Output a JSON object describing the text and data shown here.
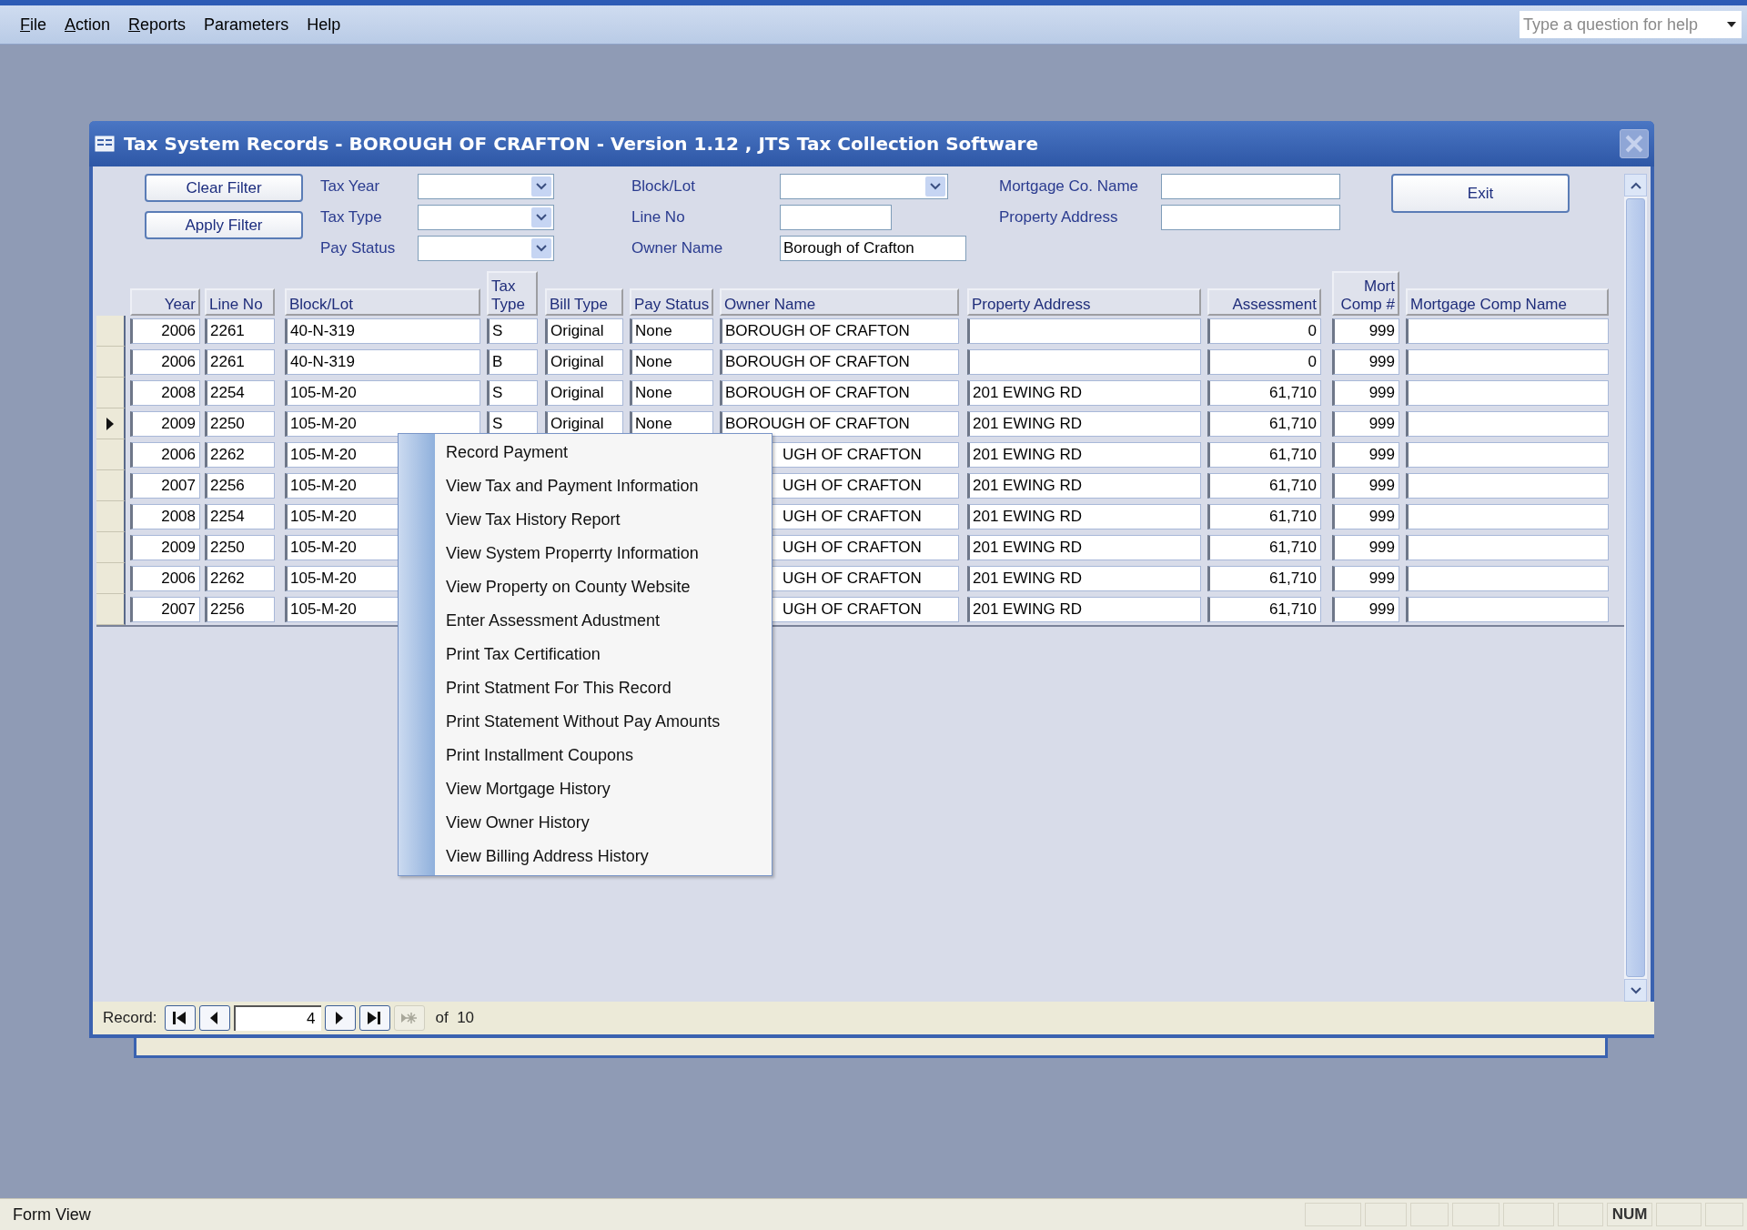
{
  "menu_bar": {
    "items": [
      {
        "label": "File",
        "underline": true
      },
      {
        "label": "Action",
        "underline": true
      },
      {
        "label": "Reports",
        "underline": true
      },
      {
        "label": "Parameters",
        "underline": false
      },
      {
        "label": "Help",
        "underline": false
      }
    ],
    "help_box": {
      "placeholder": "Type a question for help"
    }
  },
  "window": {
    "title": "Tax System Records - BOROUGH OF CRAFTON - Version 1.12 ,  JTS Tax Collection Software",
    "filter_buttons": [
      "Clear Filter",
      "Apply Filter"
    ],
    "filter_groups": [
      [
        {
          "label": "Tax Year",
          "kind": "combo"
        },
        {
          "label": "Tax Type",
          "kind": "combo"
        },
        {
          "label": "Pay Status",
          "kind": "combo"
        }
      ],
      [
        {
          "label": "Block/Lot",
          "kind": "combo"
        },
        {
          "label": "Line No",
          "kind": "text"
        },
        {
          "label": "Owner Name",
          "kind": "text",
          "value": "Borough of Crafton"
        }
      ],
      [
        {
          "label": "Mortgage Co. Name",
          "kind": "text"
        },
        {
          "label": "Property Address",
          "kind": "text"
        }
      ]
    ],
    "exit_button": "Exit",
    "table": {
      "columns": [
        "Year",
        "Line No",
        "Block/Lot",
        "Tax Type",
        "Bill Type",
        "Pay Status",
        "Owner Name",
        "Property Address",
        "Assessment",
        "Mort Comp #",
        "Mortgage Comp Name"
      ],
      "rows": [
        {
          "year": "2006",
          "line_no": "2261",
          "block_lot": "40-N-319",
          "tax_type": "S",
          "bill_type": "Original",
          "pay_status": "None",
          "owner_name": "BOROUGH OF CRAFTON",
          "assessment": "0",
          "mort_comp": "999",
          "selected": false,
          "covered": false
        },
        {
          "year": "2006",
          "line_no": "2261",
          "block_lot": "40-N-319",
          "tax_type": "B",
          "bill_type": "Original",
          "pay_status": "None",
          "owner_name": "BOROUGH OF CRAFTON",
          "assessment": "0",
          "mort_comp": "999",
          "selected": false,
          "covered": false
        },
        {
          "year": "2008",
          "line_no": "2254",
          "block_lot": "105-M-20",
          "tax_type": "S",
          "bill_type": "Original",
          "pay_status": "None",
          "owner_name": "BOROUGH OF CRAFTON",
          "property_address": "201 EWING RD",
          "assessment": "61,710",
          "mort_comp": "999",
          "selected": false,
          "covered": false
        },
        {
          "year": "2009",
          "line_no": "2250",
          "block_lot": "105-M-20",
          "tax_type": "S",
          "bill_type": "Original",
          "pay_status": "None",
          "owner_name": "BOROUGH OF CRAFTON",
          "property_address": "201 EWING RD",
          "assessment": "61,710",
          "mort_comp": "999",
          "selected": true,
          "covered": false
        },
        {
          "year": "2006",
          "line_no": "2262",
          "block_lot": "105-M-20",
          "owner_name": "UGH OF CRAFTON",
          "property_address": "201 EWING RD",
          "assessment": "61,710",
          "mort_comp": "999",
          "selected": false,
          "covered": true
        },
        {
          "year": "2007",
          "line_no": "2256",
          "block_lot": "105-M-20",
          "owner_name": "UGH OF CRAFTON",
          "property_address": "201 EWING RD",
          "assessment": "61,710",
          "mort_comp": "999",
          "selected": false,
          "covered": true
        },
        {
          "year": "2008",
          "line_no": "2254",
          "block_lot": "105-M-20",
          "owner_name": "UGH OF CRAFTON",
          "property_address": "201 EWING RD",
          "assessment": "61,710",
          "mort_comp": "999",
          "selected": false,
          "covered": true
        },
        {
          "year": "2009",
          "line_no": "2250",
          "block_lot": "105-M-20",
          "owner_name": "UGH OF CRAFTON",
          "property_address": "201 EWING RD",
          "assessment": "61,710",
          "mort_comp": "999",
          "selected": false,
          "covered": true
        },
        {
          "year": "2006",
          "line_no": "2262",
          "block_lot": "105-M-20",
          "owner_name": "UGH OF CRAFTON",
          "property_address": "201 EWING RD",
          "assessment": "61,710",
          "mort_comp": "999",
          "selected": false,
          "covered": true
        },
        {
          "year": "2007",
          "line_no": "2256",
          "block_lot": "105-M-20",
          "owner_name": "UGH OF CRAFTON",
          "property_address": "201 EWING RD",
          "assessment": "61,710",
          "mort_comp": "999",
          "selected": false,
          "covered": true
        }
      ]
    },
    "context_menu": [
      "Record Payment",
      "View Tax and Payment Information",
      "View Tax History Report",
      "View System Properrty Information",
      "View Property on County Website",
      "Enter Assessment Adustment",
      "Print Tax Certification",
      "Print Statment For This Record",
      "Print Statement Without Pay Amounts",
      "Print Installment Coupons",
      "View Mortgage History",
      "View Owner History",
      "View Billing Address History"
    ],
    "record_nav": {
      "label": "Record:",
      "current": "4",
      "total": "of  10"
    }
  },
  "status_bar": {
    "text": "Form View",
    "indicator": "NUM"
  }
}
